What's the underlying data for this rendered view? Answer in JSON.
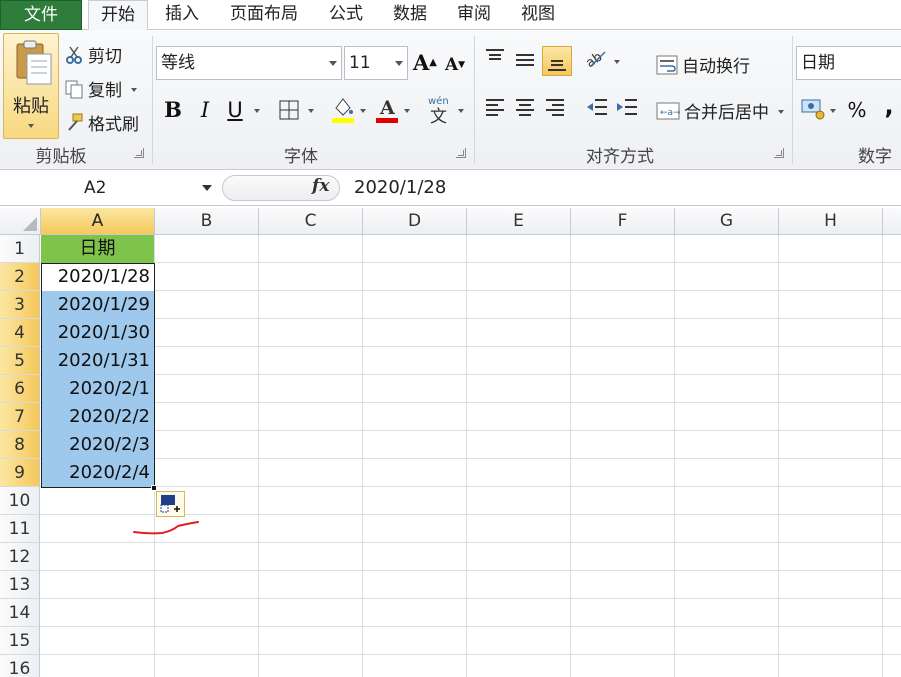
{
  "tabs": [
    "文件",
    "开始",
    "插入",
    "页面布局",
    "公式",
    "数据",
    "审阅",
    "视图"
  ],
  "clipboard": {
    "paste": "粘贴",
    "cut": "剪切",
    "copy": "复制",
    "format_painter": "格式刷",
    "label": "剪贴板"
  },
  "font": {
    "name": "等线",
    "size": "11",
    "label": "字体",
    "bold": "B",
    "italic": "I",
    "underline": "U"
  },
  "alignment": {
    "wrap_text": "自动换行",
    "merge_center": "合并后居中",
    "label": "对齐方式"
  },
  "number": {
    "format": "日期",
    "percent": "%",
    "comma": ",",
    "label": "数字"
  },
  "formula_bar": {
    "name_box": "A2",
    "fx": "fx",
    "value": "2020/1/28"
  },
  "grid": {
    "columns": [
      "A",
      "B",
      "C",
      "D",
      "E",
      "F",
      "G",
      "H"
    ],
    "rows": [
      "1",
      "2",
      "3",
      "4",
      "5",
      "6",
      "7",
      "8",
      "9",
      "10",
      "11",
      "12",
      "13",
      "14",
      "15",
      "16"
    ],
    "column_a": [
      "日期",
      "2020/1/28",
      "2020/1/29",
      "2020/1/30",
      "2020/1/31",
      "2020/2/1",
      "2020/2/2",
      "2020/2/3",
      "2020/2/4"
    ]
  },
  "colors": {
    "header_fill": "#7ec44a",
    "selection_fill": "#9ec9ec",
    "file_tab": "#2e7d3b",
    "annotation": "#e02020"
  }
}
